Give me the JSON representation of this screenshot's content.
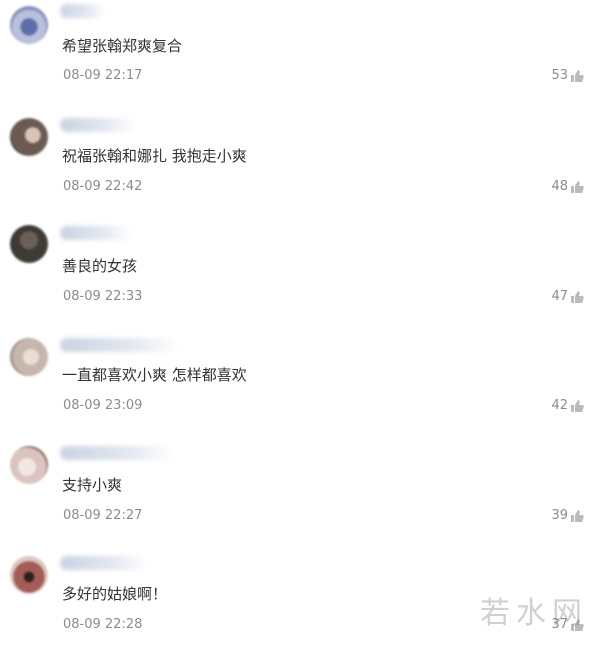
{
  "comments": [
    {
      "text": "希望张翰郑爽复合",
      "time": "08-09 22:17",
      "likes": "53",
      "avatar_icon": "user-avatar-icon",
      "avatar_color": "#8a8fb8"
    },
    {
      "text": "祝福张翰和娜扎 我抱走小爽",
      "time": "08-09 22:42",
      "likes": "48",
      "avatar_icon": "user-avatar-icon",
      "avatar_color": "#6a5a52"
    },
    {
      "text": "善良的女孩",
      "time": "08-09 22:33",
      "likes": "47",
      "avatar_icon": "user-avatar-icon",
      "avatar_color": "#3e3a36"
    },
    {
      "text": "一直都喜欢小爽 怎样都喜欢",
      "time": "08-09 23:09",
      "likes": "42",
      "avatar_icon": "user-avatar-icon",
      "avatar_color": "#c7b6ac"
    },
    {
      "text": "支持小爽",
      "time": "08-09 22:27",
      "likes": "39",
      "avatar_icon": "user-avatar-icon",
      "avatar_color": "#d9c4bf"
    },
    {
      "text": "多好的姑娘啊！",
      "time": "08-09 22:28",
      "likes": "37",
      "avatar_icon": "user-avatar-icon",
      "avatar_color": "#a45c58"
    }
  ],
  "watermark": "若水网",
  "colors": {
    "text": "#333333",
    "meta": "#8c8c8c",
    "like_icon": "#bbbbbb"
  }
}
